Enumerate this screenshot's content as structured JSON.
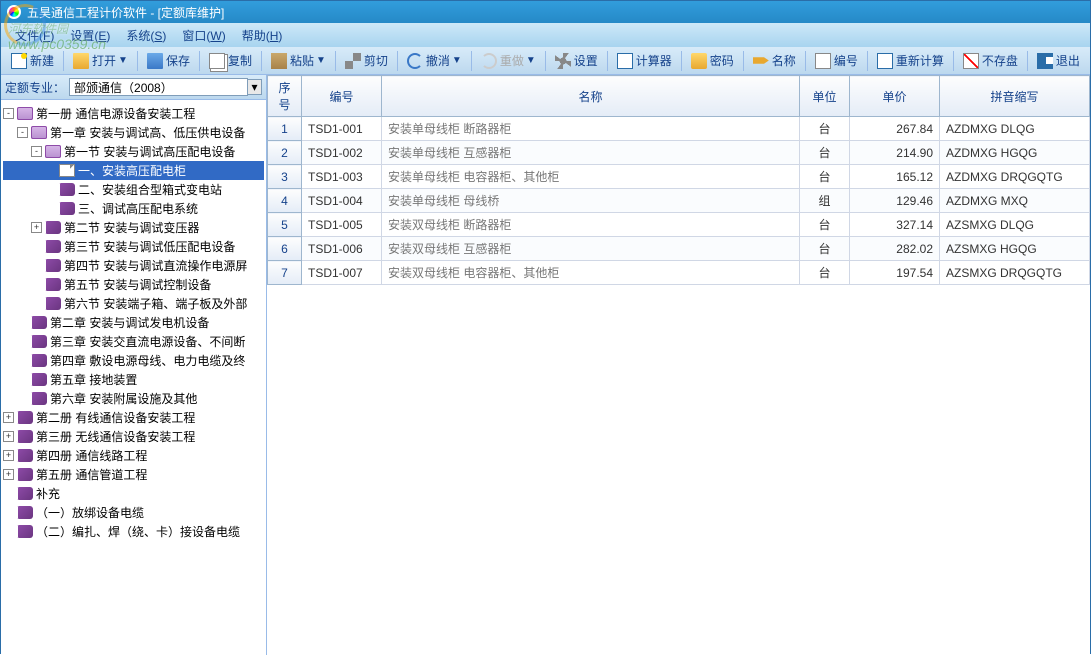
{
  "window": {
    "title": "五昊通信工程计价软件 - [定额库维护]"
  },
  "watermark": {
    "text": "河东软件园",
    "url": "www.pc0359.cn"
  },
  "menubar": {
    "items": [
      {
        "label": "文件",
        "key": "F"
      },
      {
        "label": "设置",
        "key": "E"
      },
      {
        "label": "系统",
        "key": "S"
      },
      {
        "label": "窗口",
        "key": "W"
      },
      {
        "label": "帮助",
        "key": "H"
      }
    ]
  },
  "toolbar": {
    "new": "新建",
    "open": "打开",
    "save": "保存",
    "copy": "复制",
    "paste": "粘贴",
    "cut": "剪切",
    "undo": "撤消",
    "redo": "重做",
    "settings": "设置",
    "calculator": "计算器",
    "password": "密码",
    "name": "名称",
    "number": "编号",
    "recalc": "重新计算",
    "nosave": "不存盘",
    "exit": "退出"
  },
  "filter": {
    "label": "定额专业：",
    "value": "部颁通信（2008）"
  },
  "tree": [
    {
      "level": 0,
      "toggle": "-",
      "icon": "book-open",
      "label": "第一册  通信电源设备安装工程"
    },
    {
      "level": 1,
      "toggle": "-",
      "icon": "book-open",
      "label": "第一章  安装与调试高、低压供电设备"
    },
    {
      "level": 2,
      "toggle": "-",
      "icon": "book-open",
      "label": "第一节  安装与调试高压配电设备"
    },
    {
      "level": 3,
      "toggle": "",
      "icon": "page",
      "label": "一、安装高压配电柜",
      "selected": true
    },
    {
      "level": 3,
      "toggle": "",
      "icon": "book-closed",
      "label": "二、安装组合型箱式变电站"
    },
    {
      "level": 3,
      "toggle": "",
      "icon": "book-closed",
      "label": "三、调试高压配电系统"
    },
    {
      "level": 2,
      "toggle": "+",
      "icon": "book-closed",
      "label": "第二节  安装与调试变压器"
    },
    {
      "level": 2,
      "toggle": "",
      "icon": "book-closed",
      "label": "第三节  安装与调试低压配电设备"
    },
    {
      "level": 2,
      "toggle": "",
      "icon": "book-closed",
      "label": "第四节  安装与调试直流操作电源屏"
    },
    {
      "level": 2,
      "toggle": "",
      "icon": "book-closed",
      "label": "第五节  安装与调试控制设备"
    },
    {
      "level": 2,
      "toggle": "",
      "icon": "book-closed",
      "label": "第六节  安装端子箱、端子板及外部"
    },
    {
      "level": 1,
      "toggle": "",
      "icon": "book-closed",
      "label": "第二章  安装与调试发电机设备"
    },
    {
      "level": 1,
      "toggle": "",
      "icon": "book-closed",
      "label": "第三章  安装交直流电源设备、不间断"
    },
    {
      "level": 1,
      "toggle": "",
      "icon": "book-closed",
      "label": "第四章  敷设电源母线、电力电缆及终"
    },
    {
      "level": 1,
      "toggle": "",
      "icon": "book-closed",
      "label": "第五章  接地装置"
    },
    {
      "level": 1,
      "toggle": "",
      "icon": "book-closed",
      "label": "第六章  安装附属设施及其他"
    },
    {
      "level": 0,
      "toggle": "+",
      "icon": "book-closed",
      "label": "第二册  有线通信设备安装工程"
    },
    {
      "level": 0,
      "toggle": "+",
      "icon": "book-closed",
      "label": "第三册  无线通信设备安装工程"
    },
    {
      "level": 0,
      "toggle": "+",
      "icon": "book-closed",
      "label": "第四册  通信线路工程"
    },
    {
      "level": 0,
      "toggle": "+",
      "icon": "book-closed",
      "label": "第五册  通信管道工程"
    },
    {
      "level": 0,
      "toggle": "",
      "icon": "book-closed",
      "label": "补充"
    },
    {
      "level": 0,
      "toggle": "",
      "icon": "book-closed",
      "label": "（一）放绑设备电缆"
    },
    {
      "level": 0,
      "toggle": "",
      "icon": "book-closed",
      "label": "（二）编扎、焊（绕、卡）接设备电缆"
    }
  ],
  "grid": {
    "headers": {
      "rownum": "序号",
      "code": "编号",
      "name": "名称",
      "unit": "单位",
      "price": "单价",
      "pinyin": "拼音缩写"
    },
    "rows": [
      {
        "n": "1",
        "code": "TSD1-001",
        "name": "安装单母线柜 断路器柜",
        "unit": "台",
        "price": "267.84",
        "pinyin": "AZDMXG DLQG"
      },
      {
        "n": "2",
        "code": "TSD1-002",
        "name": "安装单母线柜 互感器柜",
        "unit": "台",
        "price": "214.90",
        "pinyin": "AZDMXG HGQG"
      },
      {
        "n": "3",
        "code": "TSD1-003",
        "name": "安装单母线柜 电容器柜、其他柜",
        "unit": "台",
        "price": "165.12",
        "pinyin": "AZDMXG DRQGQTG"
      },
      {
        "n": "4",
        "code": "TSD1-004",
        "name": "安装单母线柜 母线桥",
        "unit": "组",
        "price": "129.46",
        "pinyin": "AZDMXG MXQ"
      },
      {
        "n": "5",
        "code": "TSD1-005",
        "name": "安装双母线柜 断路器柜",
        "unit": "台",
        "price": "327.14",
        "pinyin": "AZSMXG DLQG"
      },
      {
        "n": "6",
        "code": "TSD1-006",
        "name": "安装双母线柜 互感器柜",
        "unit": "台",
        "price": "282.02",
        "pinyin": "AZSMXG HGQG"
      },
      {
        "n": "7",
        "code": "TSD1-007",
        "name": "安装双母线柜 电容器柜、其他柜",
        "unit": "台",
        "price": "197.54",
        "pinyin": "AZSMXG DRQGQTG"
      }
    ]
  }
}
